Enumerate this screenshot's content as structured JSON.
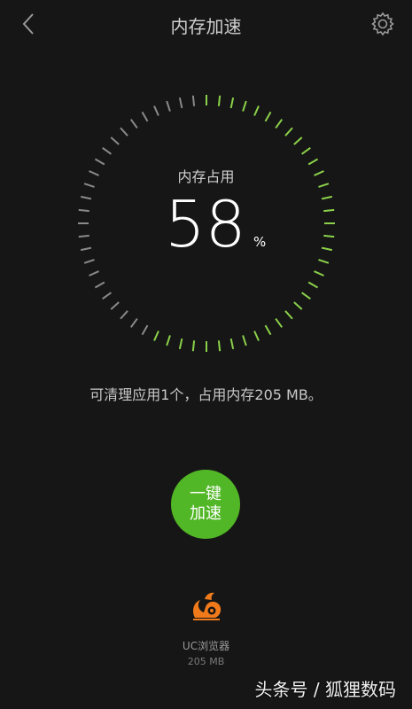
{
  "header": {
    "title": "内存加速",
    "back_icon": "chevron-left-icon",
    "settings_icon": "gear-icon"
  },
  "gauge": {
    "label": "内存占用",
    "value": "58",
    "unit": "%",
    "percent": 58,
    "active_color": "#8bd14a",
    "inactive_color": "#8a8a8a"
  },
  "summary": "可清理应用1个，占用内存205 MB。",
  "boost_button": {
    "line1": "一键",
    "line2": "加速",
    "color": "#52b726"
  },
  "apps": [
    {
      "name": "UC浏览器",
      "size": "205 MB",
      "icon": "uc-browser-squirrel-icon",
      "icon_color": "#f07a1a"
    }
  ],
  "watermark": "头条号 / 狐狸数码"
}
